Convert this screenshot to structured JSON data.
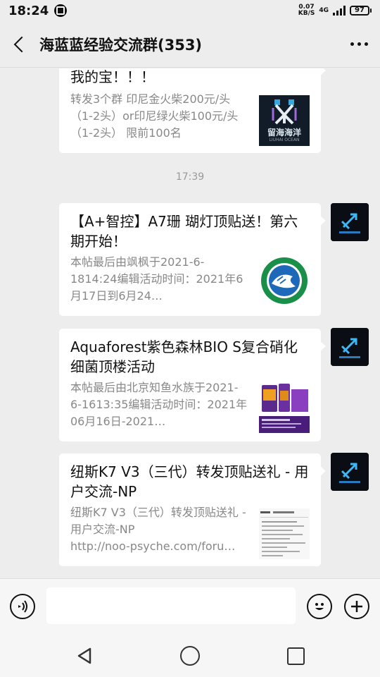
{
  "status_bar": {
    "time": "18:24",
    "net_speed_value": "0.07",
    "net_speed_unit": "KB/S",
    "network_type": "4G",
    "battery": "97"
  },
  "header": {
    "title": "海蓝蓝经验交流群(353)",
    "back_icon": "chevron-left-icon",
    "more_icon": "more-dots-icon"
  },
  "messages": [
    {
      "type": "link-card",
      "title": "我的宝！！！",
      "desc": "转发3个群 印尼金火柴200元/头（1-2头）or印尼绿火柴100元/头（1-2头） 限前100名",
      "thumb_text": "留海海洋",
      "thumb_subtext": "LIUHAI OCEAN"
    },
    {
      "type": "time-separator",
      "time": "17:39"
    },
    {
      "type": "link-card",
      "title": "【A+智控】A7珊 瑚灯顶贴送！第六期开始！",
      "desc": "本帖最后由飒枫于2021-6-1814:24编辑活动时间：2021年6月17日到6月24…"
    },
    {
      "type": "link-card",
      "title": "Aquaforest紫色森林BIO S复合硝化细菌顶楼活动",
      "desc": "本帖最后由北京知鱼水族于2021-6-1613:35编辑活动时间：2021年06月16日-2021…"
    },
    {
      "type": "link-card",
      "title": "纽斯K7 V3（三代）转发顶贴送礼 - 用户交流-NP",
      "desc": "纽斯K7 V3（三代）转发顶贴送礼 - 用户交流-NP\nhttp://noo-psyche.com/foru…"
    }
  ],
  "input_bar": {
    "voice_icon": "voice-icon",
    "emoji_icon": "emoji-icon",
    "plus_icon": "plus-icon"
  },
  "nav_bar": {
    "back_icon": "triangle-back-icon",
    "home_icon": "circle-home-icon",
    "recent_icon": "square-recent-icon"
  }
}
